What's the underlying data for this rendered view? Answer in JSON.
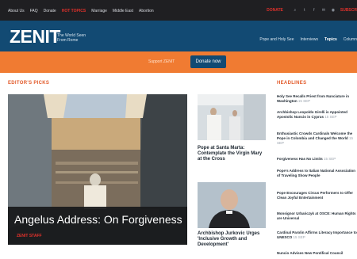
{
  "topbar": {
    "links": [
      "About Us",
      "FAQ",
      "Donate",
      "HOT TOPICS",
      "Marriage",
      "Middle East",
      "Abortion"
    ],
    "donate": "DONATE",
    "cta": "SUBSCR"
  },
  "header": {
    "logo": "ZENIT",
    "tagline": "The World Seen From Rome",
    "nav": [
      "Pope and Holy See",
      "Interviews",
      "Topics",
      "Column"
    ]
  },
  "orange_bar": {
    "support": "Support ZENIT",
    "donate_button": "Donate now"
  },
  "editors_picks": {
    "title": "EDITOR'S PICKS",
    "hero": {
      "title": "Angelus Address: On Forgiveness",
      "byline": "ZENIT STAFF"
    },
    "stories": [
      {
        "title": "Pope at Santa Marta: Contemplate the Virgin Mary at the Cross"
      },
      {
        "title": "Archbishop Jurkovic Urges 'Inclusive Growth and Development'"
      }
    ]
  },
  "headlines": {
    "title": "HEADLINES",
    "items": [
      {
        "title": "Holy See Recalls Priest from Nunciature in Washington",
        "date": "15 SEP"
      },
      {
        "title": "Archbishop Leopoldo Girelli is Appointed Apostolic Nuncio in Cyprus",
        "date": "15 SEP"
      },
      {
        "title": "Enthusiastic Crowds Cardinals Welcome the Pope in Colombia and Changed the World",
        "date": "15 SEP"
      },
      {
        "title": "Forgiveness Has No Limits",
        "date": "15 SEP"
      },
      {
        "title": "Pope's Address to Italian National Association of Traveling Show People",
        "date": ""
      },
      {
        "title": "Pope Encourages Circus Performers to Offer Clean Joyful Entertainment",
        "date": ""
      },
      {
        "title": "Monsignor Urbańczyk at OSCE: Human Rights are Universal",
        "date": ""
      },
      {
        "title": "Cardinal Parolin Affirms Literacy Importance to UNESCO",
        "date": "15 SEP"
      },
      {
        "title": "Nuncio Advises New Pontifical Council",
        "date": ""
      }
    ]
  },
  "colors": {
    "brand_blue": "#124a73",
    "orange": "#f07b32",
    "accent_red": "#e2312b"
  }
}
